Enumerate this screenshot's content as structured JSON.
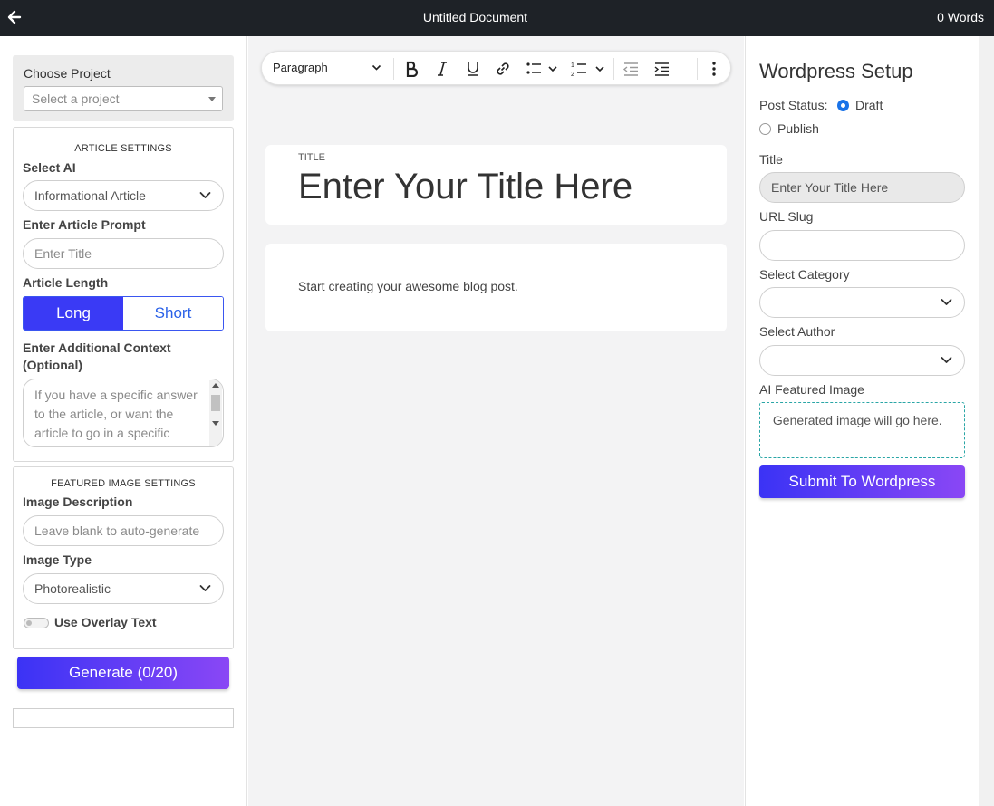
{
  "topbar": {
    "back_icon": "arrow-left-icon",
    "title": "Untitled Document",
    "word_count": "0 Words"
  },
  "left": {
    "choose_project": {
      "label": "Choose Project",
      "placeholder": "Select a project"
    },
    "article_settings": {
      "heading": "ARTICLE SETTINGS",
      "select_ai_label": "Select AI",
      "select_ai_value": "Informational Article",
      "prompt_label": "Enter Article Prompt",
      "prompt_placeholder": "Enter Title",
      "length_label": "Article Length",
      "length_options": [
        "Long",
        "Short"
      ],
      "length_selected": "Long",
      "context_label": "Enter Additional Context (Optional)",
      "context_placeholder": "If you have a specific answer to the article, or want the article to go in a specific direction, enter it here"
    },
    "image_settings": {
      "heading": "FEATURED IMAGE SETTINGS",
      "description_label": "Image Description",
      "description_placeholder": "Leave blank to auto-generate",
      "type_label": "Image Type",
      "type_value": "Photorealistic",
      "overlay_label": "Use Overlay Text",
      "overlay_on": false
    },
    "generate_button": "Generate (0/20)"
  },
  "editor": {
    "toolbar": {
      "block_format": "Paragraph",
      "icons": [
        "bold-icon",
        "italic-icon",
        "underline-icon",
        "link-icon",
        "bullet-list-icon",
        "numbered-list-icon",
        "outdent-icon",
        "indent-icon",
        "more-vertical-icon"
      ]
    },
    "title_caption": "TITLE",
    "title_placeholder": "Enter Your Title Here",
    "body_placeholder": "Start creating your awesome blog post."
  },
  "wordpress": {
    "heading": "Wordpress Setup",
    "post_status_label": "Post Status:",
    "status_options": [
      "Draft",
      "Publish"
    ],
    "status_selected": "Draft",
    "title_label": "Title",
    "title_placeholder": "Enter Your Title Here",
    "slug_label": "URL Slug",
    "slug_value": "",
    "category_label": "Select Category",
    "category_value": "",
    "author_label": "Select Author",
    "author_value": "",
    "image_label": "AI Featured Image",
    "image_alt": "Generated image will go here.",
    "submit_button": "Submit To Wordpress"
  },
  "colors": {
    "topbar": "#1e2227",
    "accent_blue": "#3a3af5",
    "gradient_start": "#3b33f5",
    "gradient_end": "#8a47f5",
    "radio_on": "#1a73e8"
  }
}
